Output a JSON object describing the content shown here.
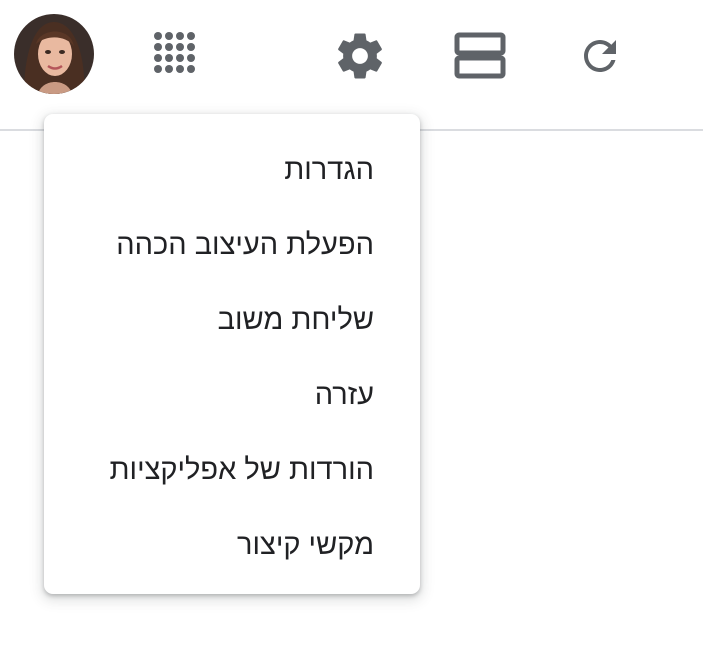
{
  "header": {
    "avatar_alt": "Account",
    "icons": {
      "apps": "apps-grid-icon",
      "settings": "gear-icon",
      "density": "split-view-icon",
      "refresh": "refresh-icon"
    }
  },
  "menu": {
    "items": [
      {
        "label": "הגדרות"
      },
      {
        "label": "הפעלת העיצוב הכהה"
      },
      {
        "label": "שליחת משוב"
      },
      {
        "label": "עזרה"
      },
      {
        "label": "הורדות של אפליקציות"
      },
      {
        "label": "מקשי קיצור"
      }
    ]
  },
  "colors": {
    "icon": "#5f6368",
    "text": "#202124",
    "divider": "#dadce0",
    "background": "#ffffff"
  }
}
